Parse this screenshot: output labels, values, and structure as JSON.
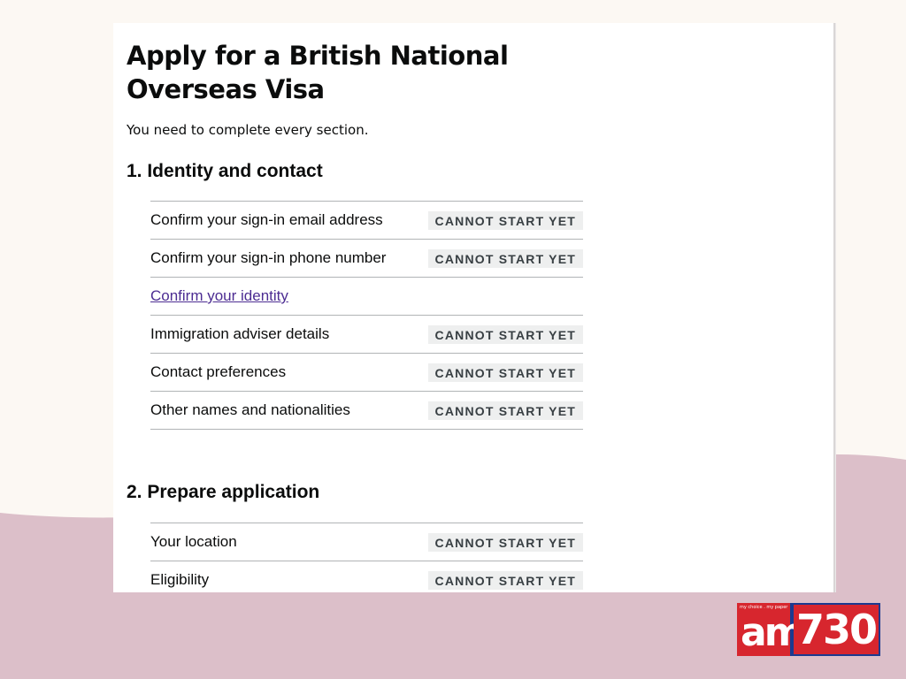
{
  "page": {
    "title": "Apply for a British National Overseas Visa",
    "intro": "You need to complete every section."
  },
  "sections": [
    {
      "heading": "1. Identity and contact",
      "tasks": [
        {
          "name": "Confirm your sign-in email address",
          "status": "CANNOT START YET"
        },
        {
          "name": "Confirm your sign-in phone number",
          "status": "CANNOT START YET"
        },
        {
          "name": "Confirm your identity",
          "status": ""
        },
        {
          "name": "Immigration adviser details",
          "status": "CANNOT START YET"
        },
        {
          "name": "Contact preferences",
          "status": "CANNOT START YET"
        },
        {
          "name": "Other names and nationalities",
          "status": "CANNOT START YET"
        }
      ]
    },
    {
      "heading": "2. Prepare application",
      "tasks": [
        {
          "name": "Your location",
          "status": "CANNOT START YET"
        },
        {
          "name": "Eligibility",
          "status": "CANNOT START YET"
        }
      ]
    }
  ],
  "logo": {
    "tagline": "my choice . my paper",
    "am_text": "am",
    "number_text": "730"
  },
  "colors": {
    "background": "#fcf8f3",
    "wave": "#dcbfc9",
    "link": "#4c2c92",
    "tag_background": "#eeefef",
    "tag_text": "#383f43",
    "logo_red": "#d7262e",
    "logo_blue": "#1b3a8f"
  }
}
